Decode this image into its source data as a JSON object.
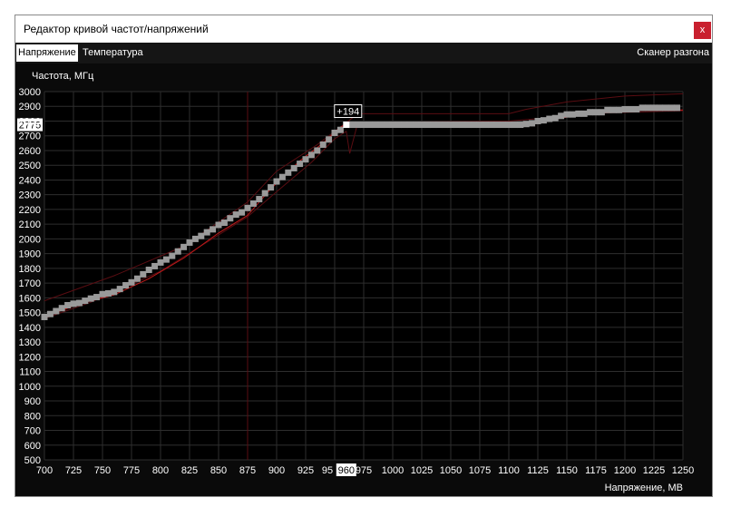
{
  "window": {
    "title": "Редактор кривой частот/напряжений",
    "close_label": "x"
  },
  "tabs": [
    {
      "label": "Напряжение",
      "active": true
    },
    {
      "label": "Температура",
      "active": false
    }
  ],
  "scanner_label": "Сканер разгона",
  "chart_data": {
    "type": "line",
    "ylabel": "Частота, МГц",
    "xlabel": "Напряжение, МВ",
    "xlim": [
      700,
      1250
    ],
    "ylim": [
      500,
      3000
    ],
    "x_ticks": [
      700,
      725,
      750,
      775,
      800,
      825,
      850,
      875,
      900,
      925,
      950,
      975,
      1000,
      1025,
      1050,
      1075,
      1100,
      1125,
      1150,
      1175,
      1200,
      1225,
      1250
    ],
    "y_ticks": [
      500,
      600,
      700,
      800,
      900,
      1000,
      1100,
      1200,
      1300,
      1400,
      1500,
      1600,
      1700,
      1800,
      1900,
      2000,
      2100,
      2200,
      2300,
      2400,
      2500,
      2600,
      2700,
      2800,
      2900,
      3000
    ],
    "x_tick_labels": [
      "700",
      "725",
      "750",
      "775",
      "800",
      "825",
      "850",
      "875",
      "900",
      "925",
      "95",
      "975",
      "1000",
      "1025",
      "1050",
      "1075",
      "1100",
      "1125",
      "1150",
      "1175",
      "1200",
      "1225",
      "1250"
    ],
    "grid": true,
    "colors": {
      "background": "#000000",
      "grid": "#2e2e2e",
      "curve": "#c21a1a",
      "points": "#9a9a9a",
      "selected": "#ffffff",
      "reference": "#5a0d12"
    },
    "selected": {
      "x": 960,
      "y": 2775,
      "offset_label": "+194",
      "x_label": "960",
      "y_label": "2775"
    },
    "reference_x": 875,
    "series": [
      {
        "role": "curve",
        "points": [
          [
            700,
            1470
          ],
          [
            730,
            1560
          ],
          [
            760,
            1620
          ],
          [
            790,
            1730
          ],
          [
            820,
            1870
          ],
          [
            850,
            2040
          ],
          [
            875,
            2160
          ],
          [
            895,
            2340
          ],
          [
            920,
            2530
          ],
          [
            940,
            2650
          ],
          [
            955,
            2760
          ],
          [
            960,
            2775
          ],
          [
            1120,
            2775
          ],
          [
            1130,
            2800
          ],
          [
            1160,
            2840
          ],
          [
            1200,
            2870
          ],
          [
            1250,
            2875
          ]
        ]
      },
      {
        "role": "upper",
        "points": [
          [
            700,
            1580
          ],
          [
            760,
            1750
          ],
          [
            820,
            1950
          ],
          [
            875,
            2250
          ],
          [
            900,
            2460
          ],
          [
            935,
            2640
          ],
          [
            955,
            2760
          ],
          [
            970,
            2850
          ],
          [
            1100,
            2850
          ],
          [
            1115,
            2880
          ],
          [
            1150,
            2930
          ],
          [
            1200,
            2970
          ],
          [
            1250,
            2985
          ]
        ]
      },
      {
        "role": "lower",
        "points": [
          [
            700,
            1460
          ],
          [
            740,
            1570
          ],
          [
            800,
            1780
          ],
          [
            875,
            2150
          ],
          [
            900,
            2320
          ],
          [
            930,
            2520
          ],
          [
            950,
            2680
          ],
          [
            960,
            2730
          ],
          [
            963,
            2580
          ],
          [
            970,
            2790
          ],
          [
            1100,
            2800
          ],
          [
            1130,
            2820
          ],
          [
            1160,
            2850
          ],
          [
            1250,
            2870
          ]
        ]
      },
      {
        "role": "points",
        "points": [
          [
            700,
            1470
          ],
          [
            705,
            1490
          ],
          [
            710,
            1510
          ],
          [
            715,
            1530
          ],
          [
            720,
            1550
          ],
          [
            725,
            1560
          ],
          [
            730,
            1565
          ],
          [
            735,
            1580
          ],
          [
            740,
            1595
          ],
          [
            745,
            1605
          ],
          [
            750,
            1625
          ],
          [
            755,
            1630
          ],
          [
            760,
            1640
          ],
          [
            765,
            1660
          ],
          [
            770,
            1685
          ],
          [
            775,
            1705
          ],
          [
            780,
            1730
          ],
          [
            785,
            1760
          ],
          [
            790,
            1790
          ],
          [
            795,
            1815
          ],
          [
            800,
            1840
          ],
          [
            805,
            1860
          ],
          [
            810,
            1885
          ],
          [
            815,
            1915
          ],
          [
            820,
            1945
          ],
          [
            825,
            1975
          ],
          [
            830,
            2000
          ],
          [
            835,
            2020
          ],
          [
            840,
            2045
          ],
          [
            845,
            2065
          ],
          [
            850,
            2095
          ],
          [
            855,
            2110
          ],
          [
            860,
            2140
          ],
          [
            865,
            2165
          ],
          [
            870,
            2180
          ],
          [
            875,
            2210
          ],
          [
            880,
            2240
          ],
          [
            885,
            2270
          ],
          [
            890,
            2310
          ],
          [
            895,
            2350
          ],
          [
            900,
            2390
          ],
          [
            905,
            2420
          ],
          [
            910,
            2450
          ],
          [
            915,
            2480
          ],
          [
            920,
            2510
          ],
          [
            925,
            2540
          ],
          [
            930,
            2570
          ],
          [
            935,
            2600
          ],
          [
            940,
            2640
          ],
          [
            945,
            2675
          ],
          [
            950,
            2720
          ],
          [
            955,
            2740
          ],
          [
            965,
            2775
          ],
          [
            970,
            2775
          ],
          [
            975,
            2775
          ],
          [
            980,
            2775
          ],
          [
            985,
            2775
          ],
          [
            990,
            2775
          ],
          [
            995,
            2775
          ],
          [
            1000,
            2775
          ],
          [
            1005,
            2775
          ],
          [
            1010,
            2775
          ],
          [
            1015,
            2775
          ],
          [
            1020,
            2775
          ],
          [
            1025,
            2775
          ],
          [
            1030,
            2775
          ],
          [
            1035,
            2775
          ],
          [
            1040,
            2775
          ],
          [
            1045,
            2775
          ],
          [
            1050,
            2775
          ],
          [
            1055,
            2775
          ],
          [
            1060,
            2775
          ],
          [
            1065,
            2775
          ],
          [
            1070,
            2775
          ],
          [
            1075,
            2775
          ],
          [
            1080,
            2775
          ],
          [
            1085,
            2775
          ],
          [
            1090,
            2775
          ],
          [
            1095,
            2775
          ],
          [
            1100,
            2775
          ],
          [
            1105,
            2775
          ],
          [
            1110,
            2775
          ],
          [
            1115,
            2780
          ],
          [
            1120,
            2785
          ],
          [
            1125,
            2800
          ],
          [
            1130,
            2805
          ],
          [
            1135,
            2815
          ],
          [
            1140,
            2820
          ],
          [
            1145,
            2835
          ],
          [
            1150,
            2845
          ],
          [
            1155,
            2845
          ],
          [
            1160,
            2850
          ],
          [
            1165,
            2850
          ],
          [
            1170,
            2860
          ],
          [
            1175,
            2860
          ],
          [
            1180,
            2860
          ],
          [
            1185,
            2875
          ],
          [
            1190,
            2875
          ],
          [
            1195,
            2875
          ],
          [
            1200,
            2880
          ],
          [
            1205,
            2880
          ],
          [
            1210,
            2880
          ],
          [
            1215,
            2890
          ],
          [
            1220,
            2890
          ],
          [
            1225,
            2890
          ],
          [
            1230,
            2890
          ],
          [
            1235,
            2890
          ],
          [
            1240,
            2890
          ],
          [
            1245,
            2890
          ]
        ]
      }
    ]
  }
}
